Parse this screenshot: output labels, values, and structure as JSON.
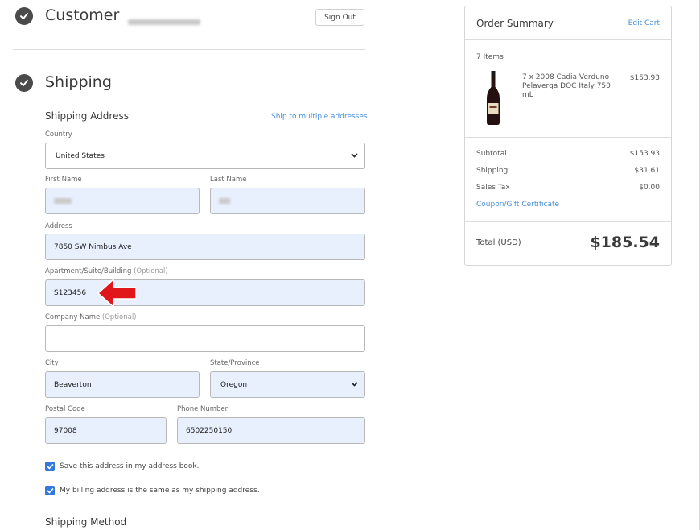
{
  "customer": {
    "title": "Customer",
    "sign_out_label": "Sign Out"
  },
  "shipping": {
    "title": "Shipping",
    "address_title": "Shipping Address",
    "multi_link": "Ship to multiple addresses",
    "country_label": "Country",
    "country_value": "United States",
    "first_name_label": "First Name",
    "last_name_label": "Last Name",
    "address_label": "Address",
    "address_value": "7850 SW Nimbus Ave",
    "apt_label": "Apartment/Suite/Building",
    "apt_optional": "(Optional)",
    "apt_value": "S123456",
    "company_label": "Company Name",
    "company_optional": "(Optional)",
    "company_value": "",
    "city_label": "City",
    "city_value": "Beaverton",
    "state_label": "State/Province",
    "state_value": "Oregon",
    "postal_label": "Postal Code",
    "postal_value": "97008",
    "phone_label": "Phone Number",
    "phone_value": "6502250150",
    "save_address_label": "Save this address in my address book.",
    "billing_same_label": "My billing address is the same as my shipping address.",
    "method_title": "Shipping Method"
  },
  "summary": {
    "title": "Order Summary",
    "edit_cart": "Edit Cart",
    "items_count": "7 Items",
    "item_name": "7 x 2008 Cadia Verduno Pelaverga DOC Italy 750 mL",
    "item_price": "$153.93",
    "subtotal_label": "Subtotal",
    "subtotal_value": "$153.93",
    "shipping_label": "Shipping",
    "shipping_value": "$31.61",
    "tax_label": "Sales Tax",
    "tax_value": "$0.00",
    "coupon_link": "Coupon/Gift Certificate",
    "total_label": "Total (USD)",
    "total_value": "$185.54"
  },
  "colors": {
    "accent": "#4a90d9",
    "autofill": "#e8f0fe",
    "arrow": "#e0161b",
    "checkbox": "#3478d9"
  },
  "icons": {
    "step_done": "check-circle-icon",
    "select": "chevron-down-icon",
    "annotation": "red-arrow-icon",
    "product": "wine-bottle-icon"
  }
}
